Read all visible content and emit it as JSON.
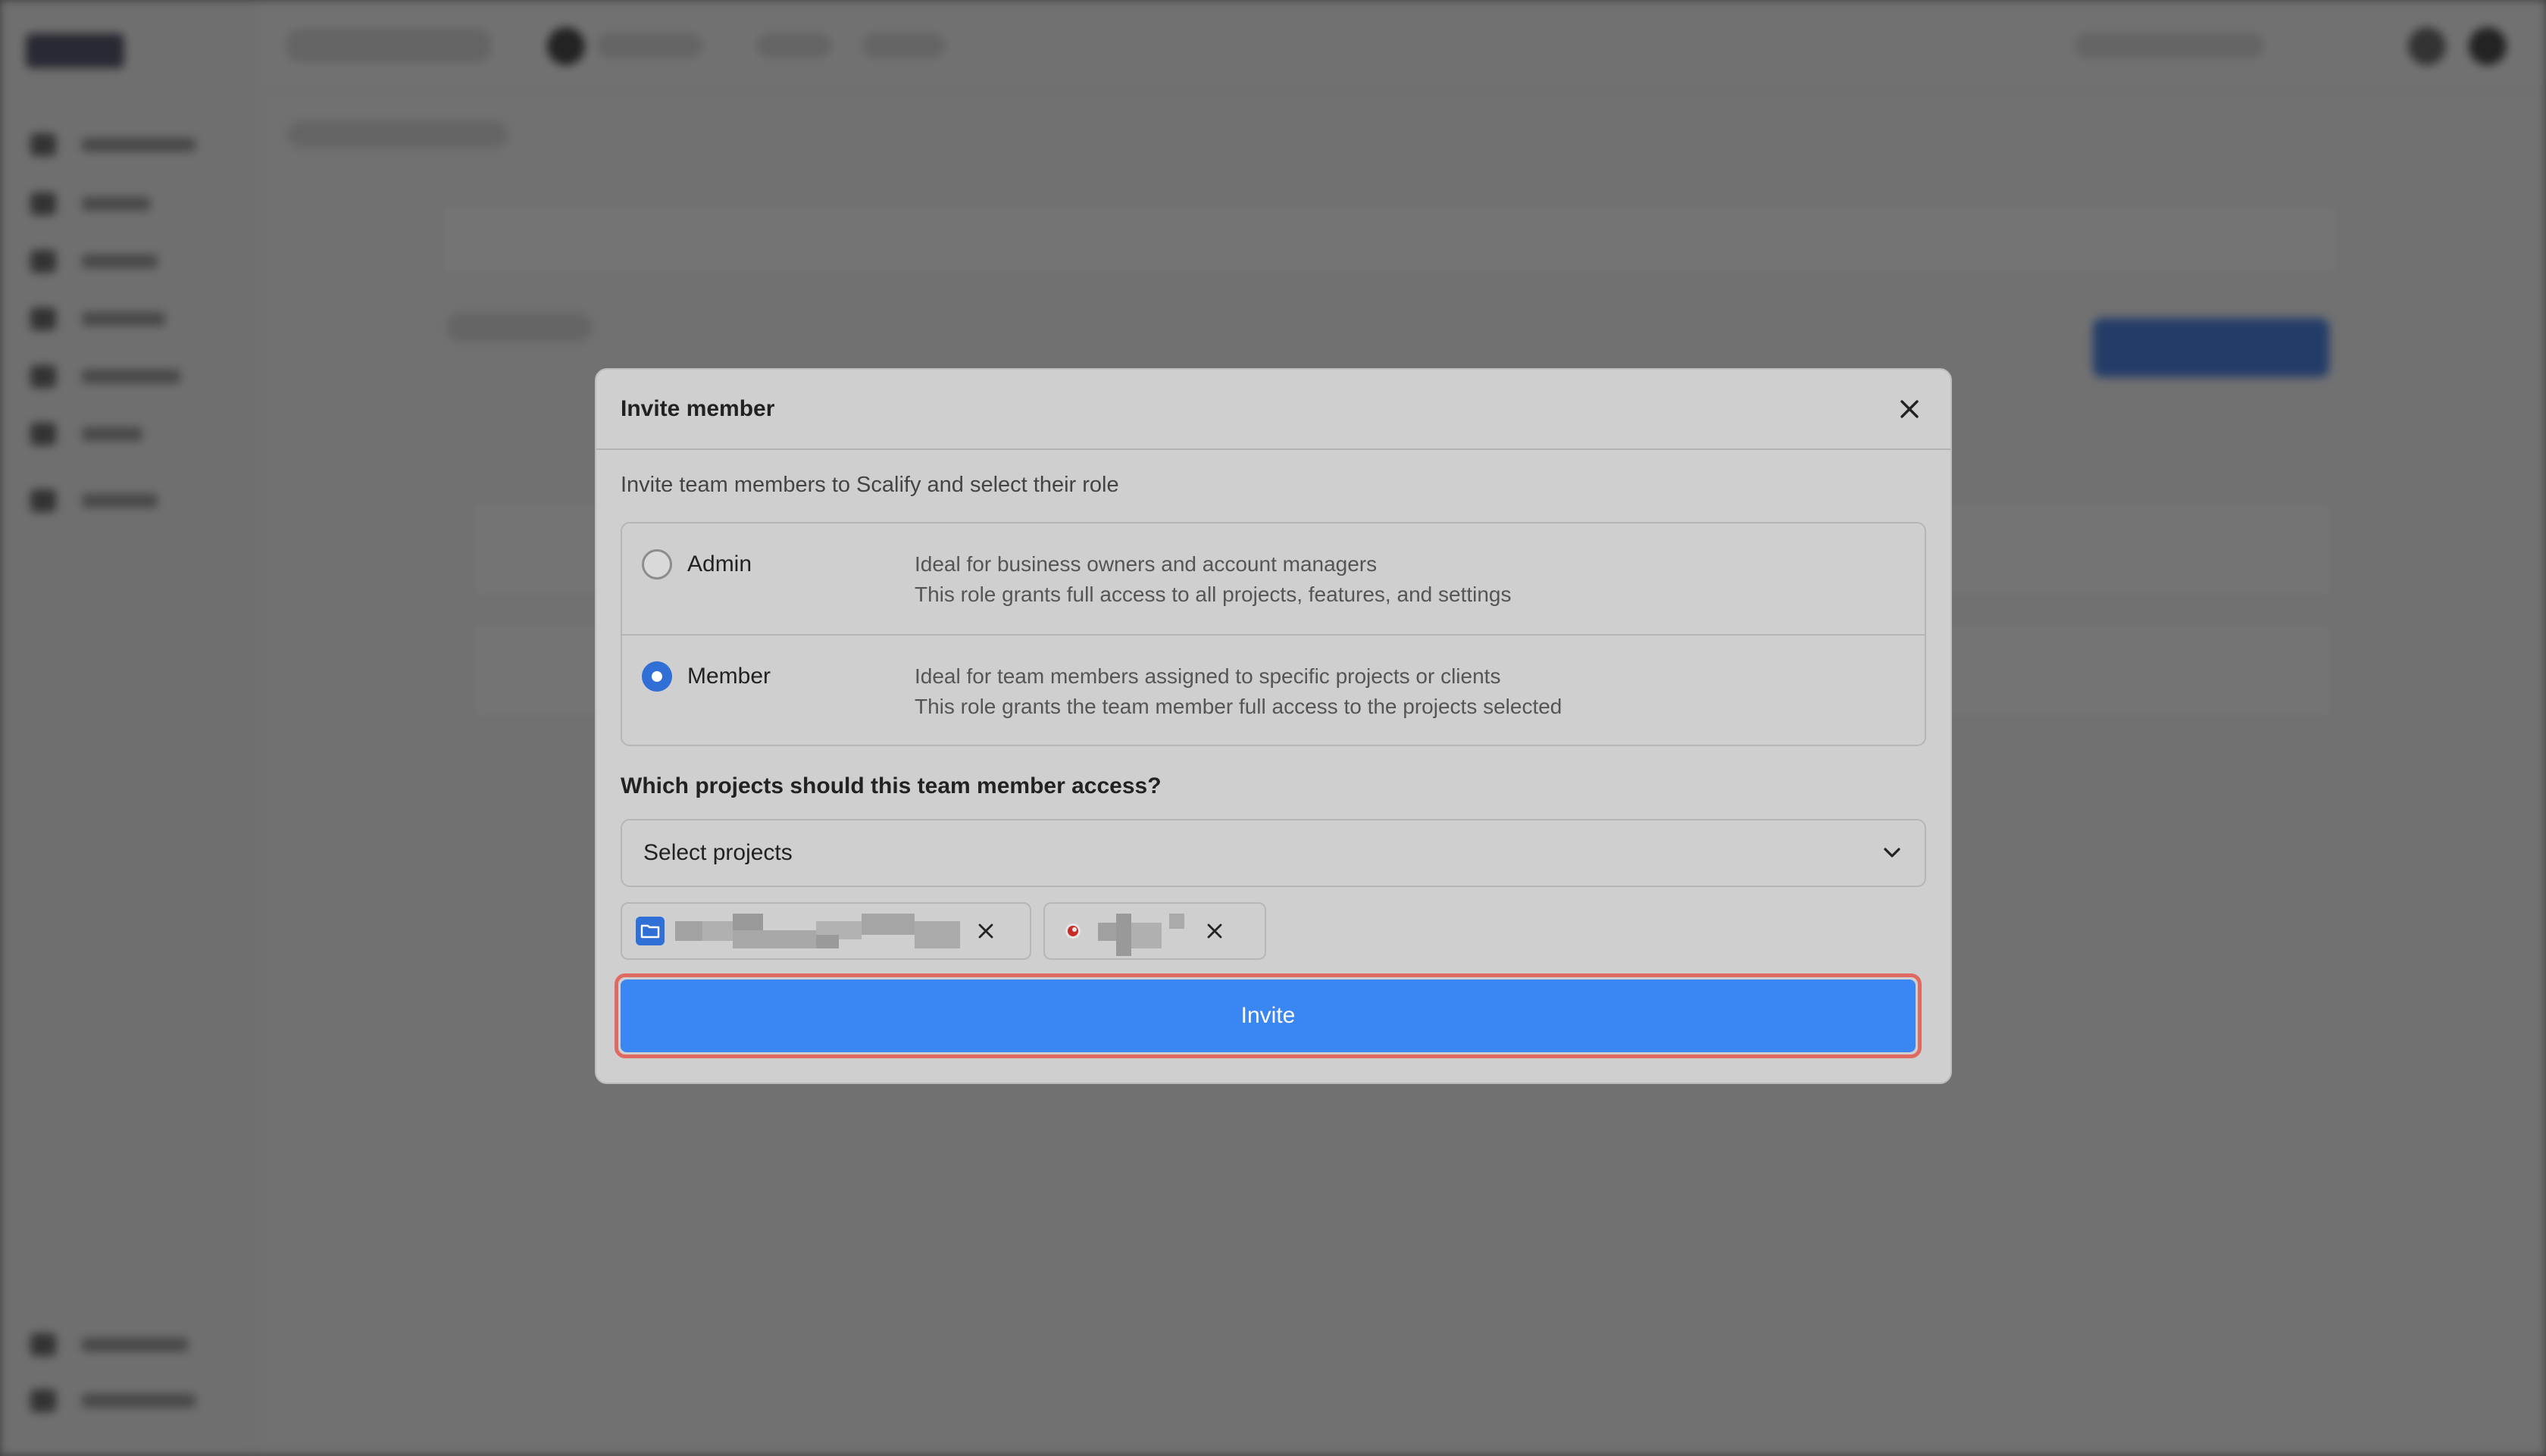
{
  "modal": {
    "title": "Invite member",
    "subtitle": "Invite team members to Scalify and select their role",
    "roles": [
      {
        "name": "Admin",
        "selected": false,
        "desc_line1": "Ideal for business owners and account managers",
        "desc_line2": "This role grants full access to all projects, features, and settings"
      },
      {
        "name": "Member",
        "selected": true,
        "desc_line1": "Ideal for team members assigned to specific projects or clients",
        "desc_line2": "This role grants the team member full access to the projects selected"
      }
    ],
    "projects_question": "Which projects should this team member access?",
    "select_placeholder": "Select projects",
    "selected_projects": [
      {
        "icon": "folder-icon",
        "name_redacted": true
      },
      {
        "icon": "brand-logo-icon",
        "name_redacted": true
      }
    ],
    "invite_label": "Invite"
  },
  "colors": {
    "primary": "#3a86f2",
    "radio_selected": "#2f6fd6",
    "highlight_outline": "#e06a61",
    "overlay": "rgba(30,30,30,0.62)"
  }
}
